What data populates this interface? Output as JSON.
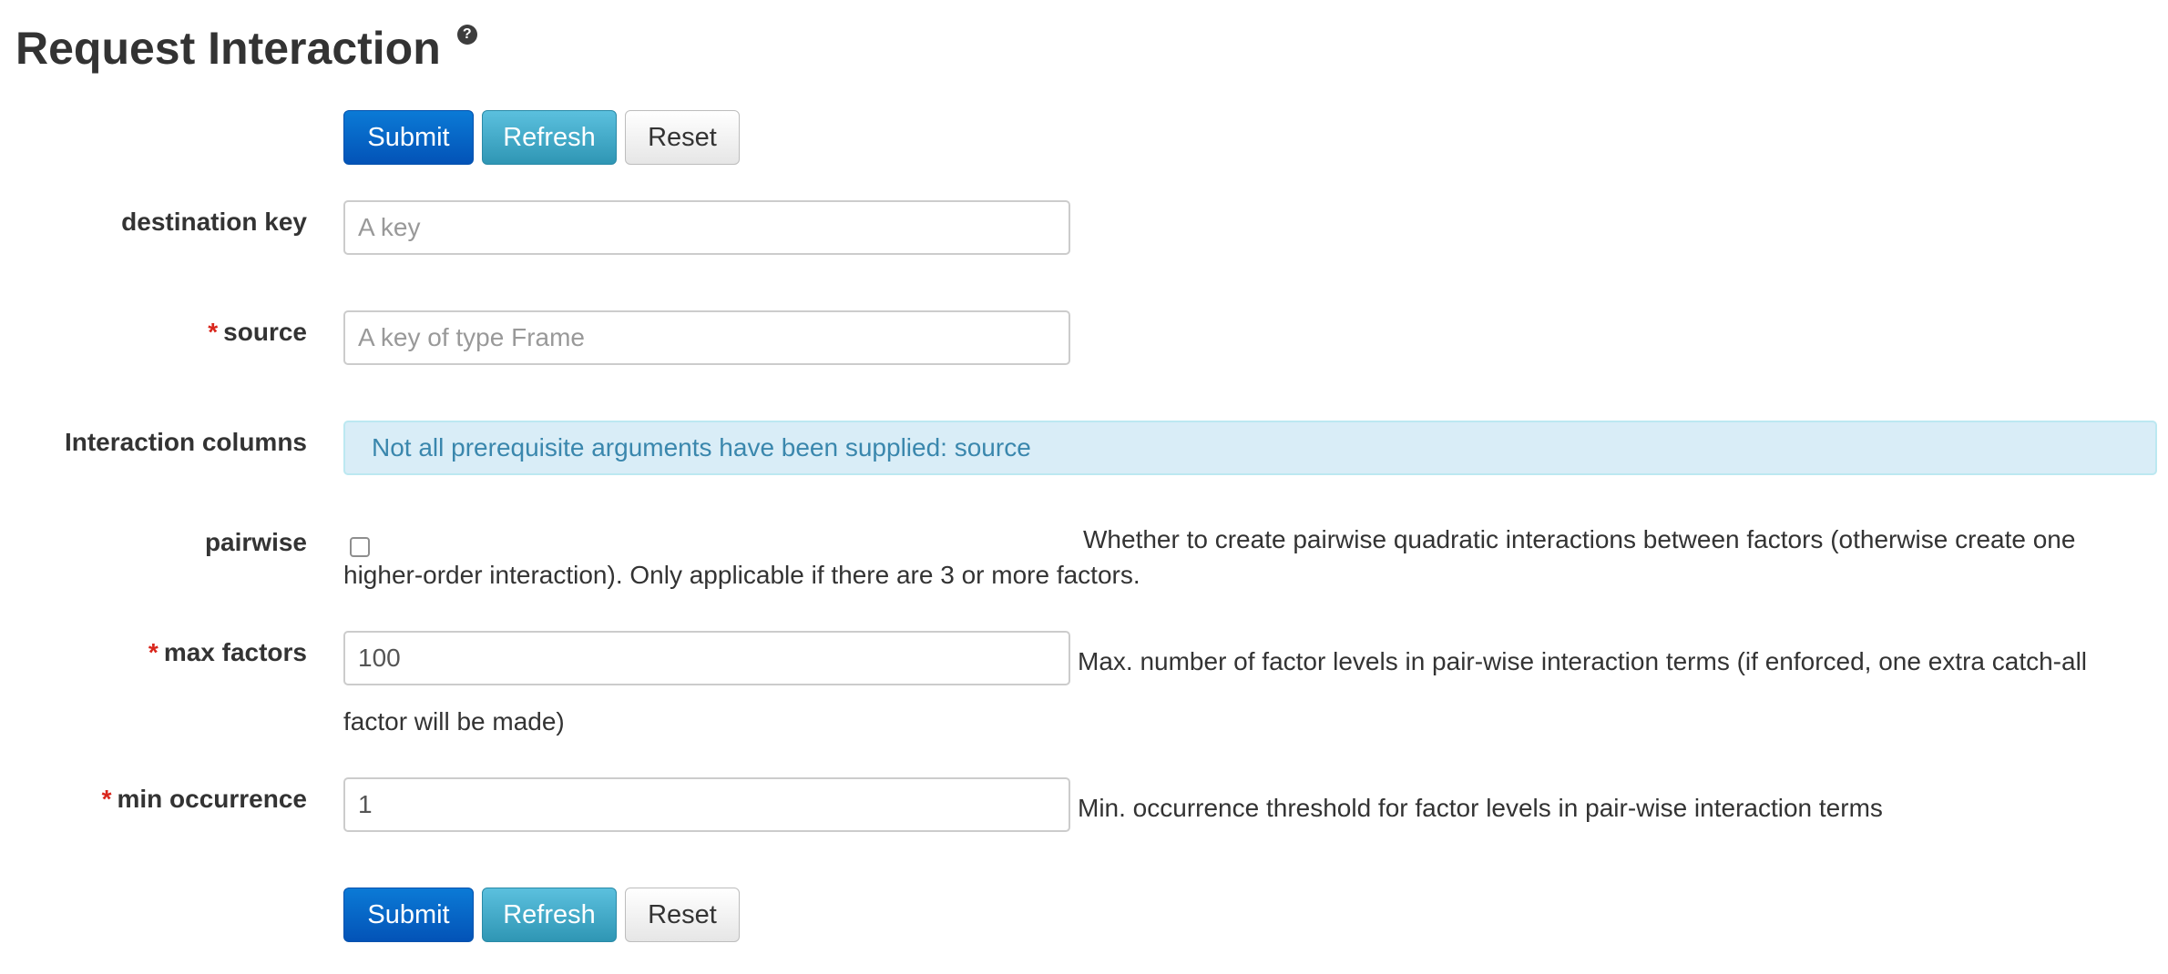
{
  "page": {
    "title": "Request Interaction",
    "help_icon_glyph": "?"
  },
  "buttons_top": {
    "submit": "Submit",
    "refresh": "Refresh",
    "reset": "Reset"
  },
  "buttons_bottom": {
    "submit": "Submit",
    "refresh": "Refresh",
    "reset": "Reset"
  },
  "form": {
    "destination_key": {
      "label": "destination key",
      "value": "",
      "placeholder": "A key",
      "required": false
    },
    "source": {
      "label": "source",
      "value": "",
      "placeholder": "A key of type Frame",
      "required": true
    },
    "interaction_columns": {
      "label": "Interaction columns",
      "alert": "Not all prerequisite arguments have been supplied: source"
    },
    "pairwise": {
      "label": "pairwise",
      "checked": false,
      "help_line1": "Whether to create pairwise quadratic interactions between factors (otherwise create one",
      "help_line2": "higher-order interaction). Only applicable if there are 3 or more factors."
    },
    "max_factors": {
      "label": "max factors",
      "value": "100",
      "required": true,
      "help_line1": "Max. number of factor levels in pair-wise interaction terms (if enforced, one extra catch-all",
      "help_line2": "factor will be made)"
    },
    "min_occurrence": {
      "label": "min occurrence",
      "value": "1",
      "required": true,
      "help": "Min. occurrence threshold for factor levels in pair-wise interaction terms"
    },
    "required_marker": "*"
  },
  "colors": {
    "primary": "#0353b7",
    "info": "#2f96b4",
    "alert_bg": "#d9edf7",
    "alert_text": "#3a87ad",
    "required": "#d9261c"
  }
}
